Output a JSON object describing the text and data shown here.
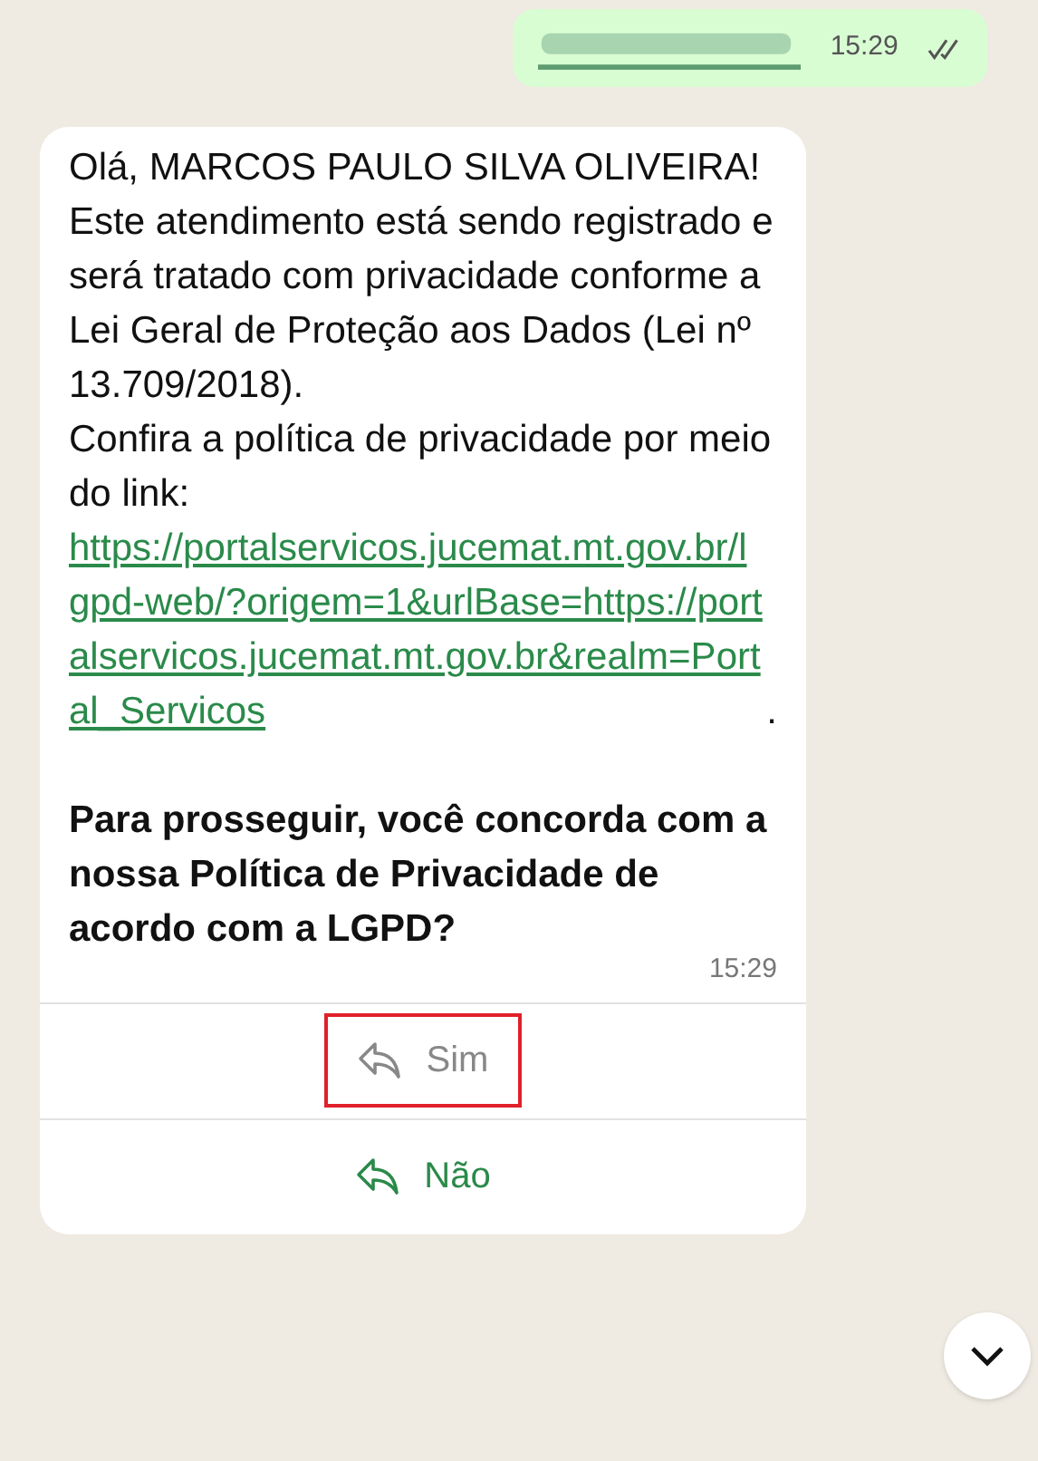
{
  "outgoing": {
    "time": "15:29",
    "read": true
  },
  "incoming": {
    "greeting": "Olá, MARCOS PAULO SILVA OLIVEIRA!",
    "notice": "Este atendimento está sendo registrado e será tratado com privacidade conforme a Lei Geral de Proteção aos Dados (Lei nº 13.709/2018).",
    "link_intro": "Confira a política de privacidade por meio do link: ",
    "link": "https://portalservicos.jucemat.mt.gov.br/lgpd-web/?origem=1&urlBase=https://portalservicos.jucemat.mt.gov.br&realm=Portal_Servicos",
    "link_end": ".",
    "question": "Para prosseguir, você concorda com a nossa Política de Privacidade de acordo com a LGPD?",
    "time": "15:29"
  },
  "replies": [
    {
      "label": "Sim",
      "disabled": true,
      "highlighted": true
    },
    {
      "label": "Não",
      "disabled": false,
      "highlighted": false
    }
  ]
}
